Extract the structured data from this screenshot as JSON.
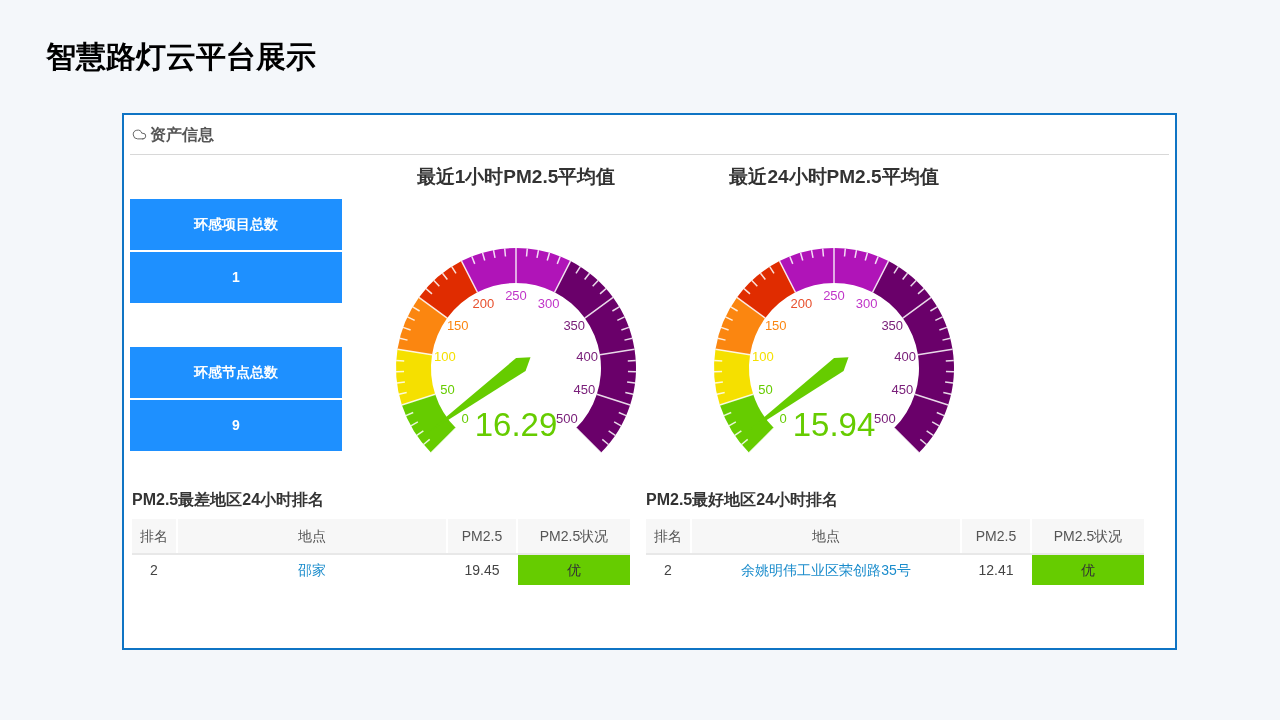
{
  "slide_title": "智慧路灯云平台展示",
  "panel": {
    "title": "资产信息"
  },
  "stats": [
    {
      "label": "环感项目总数",
      "value": "1"
    },
    {
      "label": "环感节点总数",
      "value": "9"
    }
  ],
  "gauges": [
    {
      "title": "最近1小时PM2.5平均值",
      "reading": "16.29",
      "scale_labels": [
        "0",
        "50",
        "100",
        "150",
        "200",
        "250",
        "300",
        "350",
        "400",
        "450",
        "500"
      ]
    },
    {
      "title": "最近24小时PM2.5平均值",
      "reading": "15.94",
      "scale_labels": [
        "0",
        "50",
        "100",
        "150",
        "200",
        "250",
        "300",
        "350",
        "400",
        "450",
        "500"
      ]
    }
  ],
  "tables": [
    {
      "title": "PM2.5最差地区24小时排名",
      "columns": [
        "排名",
        "地点",
        "PM2.5",
        "PM2.5状况"
      ],
      "rows": [
        {
          "rank": "2",
          "location": "邵家",
          "pm25": "19.45",
          "status": "优",
          "color": "#66cc00"
        }
      ]
    },
    {
      "title": "PM2.5最好地区24小时排名",
      "columns": [
        "排名",
        "地点",
        "PM2.5",
        "PM2.5状况"
      ],
      "rows": [
        {
          "rank": "2",
          "location": "余姚明伟工业区荣创路35号",
          "pm25": "12.41",
          "status": "优",
          "color": "#66cc00"
        }
      ]
    }
  ]
}
